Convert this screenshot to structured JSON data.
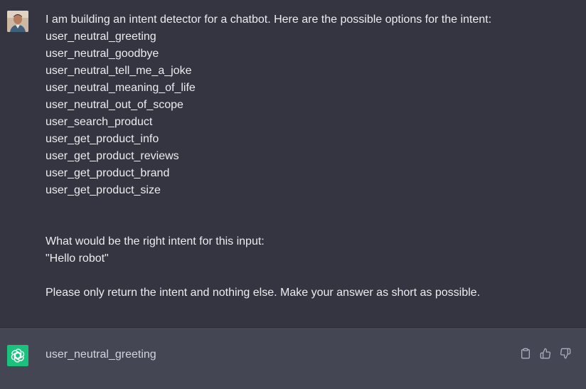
{
  "user_message": {
    "lines": [
      "I am building an intent detector for a chatbot. Here are the possible options for the intent:",
      "user_neutral_greeting",
      "user_neutral_goodbye",
      "user_neutral_tell_me_a_joke",
      "user_neutral_meaning_of_life",
      "user_neutral_out_of_scope",
      "user_search_product",
      "user_get_product_info",
      "user_get_product_reviews",
      "user_get_product_brand",
      "user_get_product_size",
      "",
      "",
      "What would be the right intent for this input:",
      "\"Hello robot\"",
      "",
      "Please only return the intent and nothing else. Make your answer as short as possible."
    ]
  },
  "assistant_message": {
    "text": "user_neutral_greeting"
  },
  "icons": {
    "user_avatar": "user-avatar",
    "assistant_avatar": "openai-logo-icon",
    "copy": "clipboard-icon",
    "like": "thumbs-up-icon",
    "dislike": "thumbs-down-icon"
  },
  "colors": {
    "background": "#343541",
    "assistant_background": "#444654",
    "assistant_avatar": "#19c37d",
    "text": "#ececf1"
  }
}
